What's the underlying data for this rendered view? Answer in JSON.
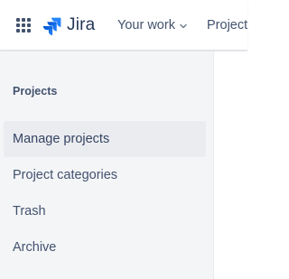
{
  "header": {
    "app_switcher_icon": "app-switcher-grid-icon",
    "logo_text": "Jira",
    "logo_color": "#2684ff",
    "nav": [
      {
        "label": "Your work",
        "has_dropdown": true
      },
      {
        "label": "Project"
      }
    ]
  },
  "sidebar": {
    "heading": "Projects",
    "items": [
      {
        "label": "Manage projects",
        "selected": true
      },
      {
        "label": "Project categories",
        "selected": false
      },
      {
        "label": "Trash",
        "selected": false
      },
      {
        "label": "Archive",
        "selected": false
      }
    ]
  },
  "colors": {
    "text_primary": "#42526e",
    "sidebar_bg": "#f4f5f7",
    "selected_bg": "#ebecf0",
    "brand_blue": "#2684ff"
  }
}
